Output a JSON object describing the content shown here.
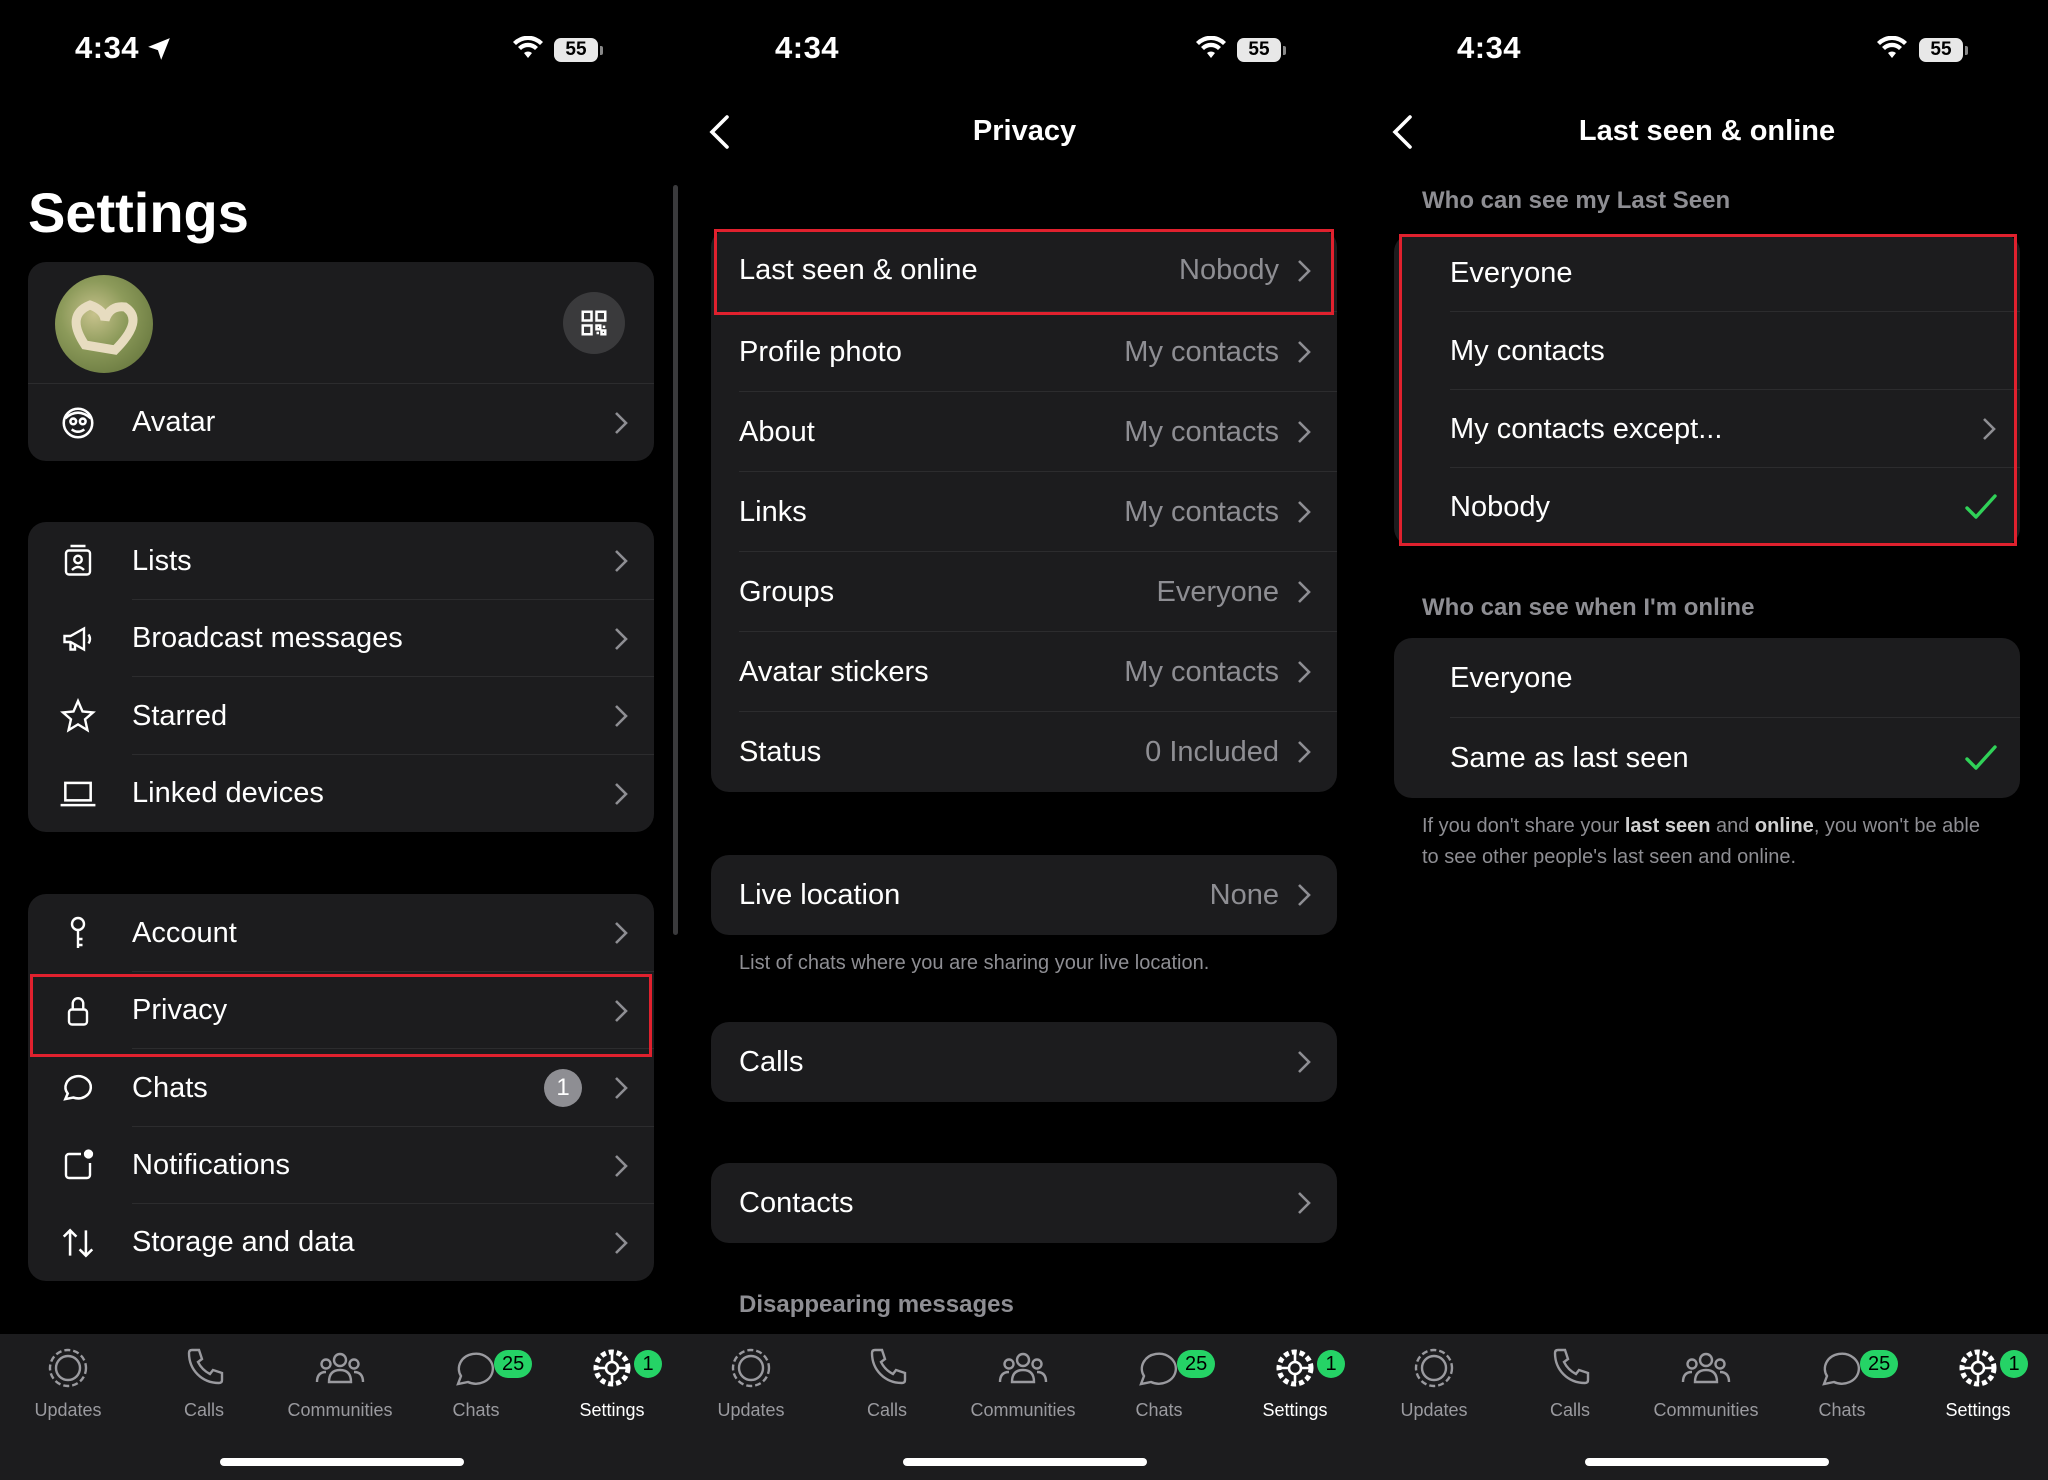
{
  "status": {
    "time": "4:34",
    "battery": "55"
  },
  "settings_screen": {
    "title": "Settings",
    "avatar_label": "Avatar",
    "group1": [
      "Lists",
      "Broadcast messages",
      "Starred",
      "Linked devices"
    ],
    "group2": [
      "Account",
      "Privacy",
      "Chats",
      "Notifications",
      "Storage and data"
    ],
    "chats_count": "1"
  },
  "privacy_screen": {
    "title": "Privacy",
    "rows": [
      {
        "label": "Last seen & online",
        "value": "Nobody"
      },
      {
        "label": "Profile photo",
        "value": "My contacts"
      },
      {
        "label": "About",
        "value": "My contacts"
      },
      {
        "label": "Links",
        "value": "My contacts"
      },
      {
        "label": "Groups",
        "value": "Everyone"
      },
      {
        "label": "Avatar stickers",
        "value": "My contacts"
      },
      {
        "label": "Status",
        "value": "0 Included"
      }
    ],
    "live_location": {
      "label": "Live location",
      "value": "None"
    },
    "live_location_note": "List of chats where you are sharing your live location.",
    "calls_label": "Calls",
    "contacts_label": "Contacts",
    "disappearing_label": "Disappearing messages"
  },
  "last_seen_screen": {
    "title": "Last seen & online",
    "section1": "Who can see my Last Seen",
    "options1": [
      "Everyone",
      "My contacts",
      "My contacts except...",
      "Nobody"
    ],
    "section2": "Who can see when I'm online",
    "options2": [
      "Everyone",
      "Same as last seen"
    ],
    "note_pre": "If you don't share your ",
    "note_b1": "last seen",
    "note_mid": " and ",
    "note_b2": "online",
    "note_post": ", you won't be able to see other people's last seen and online."
  },
  "tabbar": {
    "tabs": [
      "Updates",
      "Calls",
      "Communities",
      "Chats",
      "Settings"
    ],
    "chats_badge": "25",
    "settings_badge": "1"
  },
  "colors": {
    "accent_green": "#25d366",
    "highlight_red": "#e0212e",
    "check_green": "#30d158"
  }
}
